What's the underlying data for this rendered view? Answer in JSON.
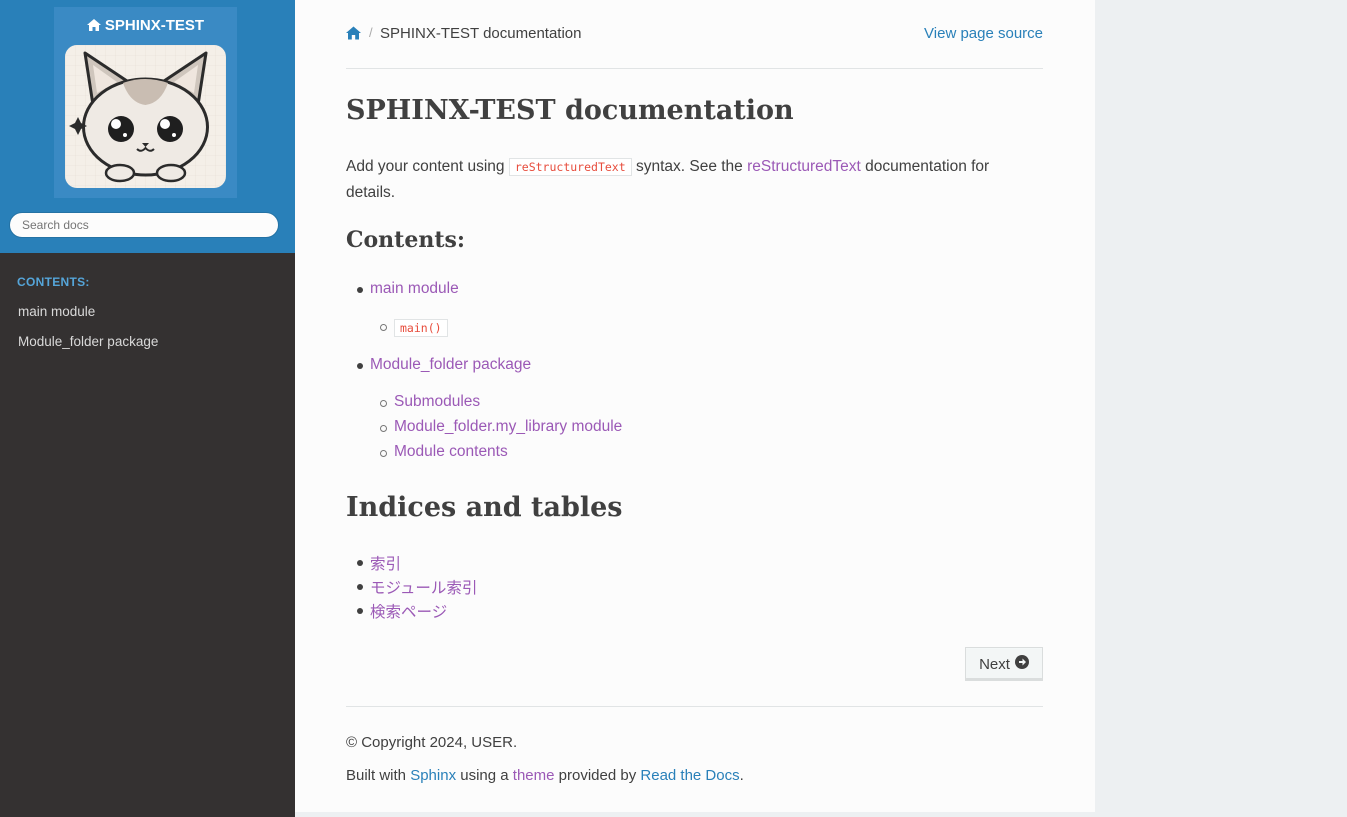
{
  "sidebar": {
    "project_title": "SPHINX-TEST",
    "search_placeholder": "Search docs",
    "caption": "CONTENTS:",
    "items": [
      {
        "label": "main module"
      },
      {
        "label": "Module_folder package"
      }
    ]
  },
  "breadcrumb": {
    "separator": "/",
    "current": "SPHINX-TEST documentation",
    "source_link": "View page source"
  },
  "main": {
    "title": "SPHINX-TEST documentation",
    "intro": {
      "pre": "Add your content using ",
      "code": "reStructuredText",
      "mid": " syntax. See the ",
      "link": "reStructuredText",
      "post": " documentation for",
      "post2": "details."
    },
    "contents_heading": "Contents:",
    "toc": {
      "main_module": "main module",
      "main_func": "main()",
      "package": "Module_folder package",
      "submodules": "Submodules",
      "my_library": "Module_folder.my_library module",
      "module_contents": "Module contents"
    },
    "indices_heading": "Indices and tables",
    "indices": [
      "索引",
      "モジュール索引",
      "検索ページ"
    ]
  },
  "nav": {
    "next_label": "Next"
  },
  "footer": {
    "copyright": "© Copyright 2024, USER.",
    "built_pre": "Built with ",
    "sphinx": "Sphinx",
    "using": " using a ",
    "theme": "theme",
    "provided": " provided by ",
    "rtd": "Read the Docs",
    "dot": "."
  },
  "colors": {
    "sidebar_top": "#2980b9",
    "sidebar_bg": "#343131",
    "link_visited": "#9b59b6",
    "link": "#2980b9",
    "code": "#e74c3c"
  },
  "icons": [
    "home-icon",
    "cat-logo",
    "circle-arrow-right-icon"
  ]
}
